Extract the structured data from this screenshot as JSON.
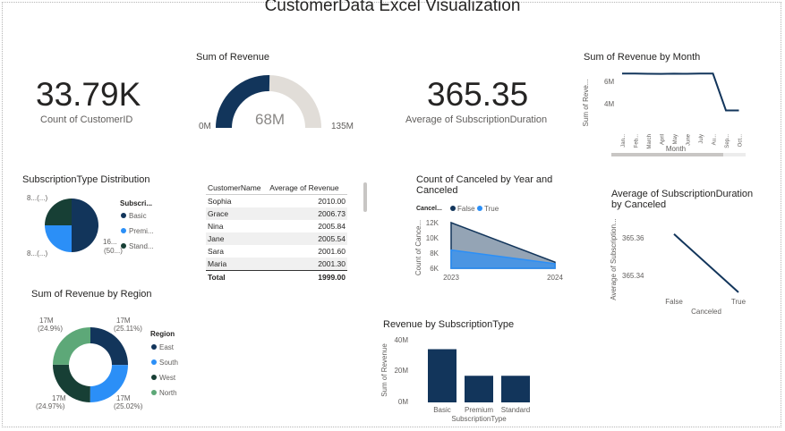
{
  "report": {
    "title": "CustomerData Excel Visualization"
  },
  "kpi_count": {
    "value": "33.79K",
    "label": "Count of CustomerID"
  },
  "gauge": {
    "title": "Sum of Revenue",
    "value": "68M",
    "min": "0M",
    "max": "135M",
    "fraction": 0.504
  },
  "kpi_duration": {
    "value": "365.35",
    "label": "Average of SubscriptionDuration"
  },
  "month_chart": {
    "title": "Sum of Revenue by Month",
    "ylabel": "Sum of Reve...",
    "xlabel": "Month",
    "yticks": [
      "6M",
      "4M"
    ],
    "months": [
      "Jan...",
      "Feb...",
      "March",
      "April",
      "May",
      "June",
      "July",
      "Au...",
      "Sep...",
      "Oct..."
    ],
    "values": [
      6.7,
      6.7,
      6.68,
      6.67,
      6.69,
      6.68,
      6.7,
      6.7,
      3.4,
      3.4
    ]
  },
  "sub_pie": {
    "title": "SubscriptionType Distribution",
    "legend_title": "Subscri...",
    "legend": [
      {
        "label": "Basic",
        "color": "#12355b"
      },
      {
        "label": "Premi...",
        "color": "#2b8ff7"
      },
      {
        "label": "Stand...",
        "color": "#173f35"
      }
    ],
    "labels": {
      "top": "8...(...)",
      "right": "16...",
      "right2": "(50...)",
      "bottom": "8...(...)"
    }
  },
  "table": {
    "headers": [
      "CustomerName",
      "Average of Revenue"
    ],
    "rows": [
      [
        "Sophia",
        "2010.00"
      ],
      [
        "Grace",
        "2006.73"
      ],
      [
        "Nina",
        "2005.84"
      ],
      [
        "Jane",
        "2005.54"
      ],
      [
        "Sara",
        "2001.60"
      ],
      [
        "Maria",
        "2001.30"
      ]
    ],
    "total": [
      "Total",
      "1999.00"
    ]
  },
  "area_chart": {
    "title": "Count of Canceled by Year and Canceled",
    "legend_title": "Cancel...",
    "legend": [
      {
        "label": "False",
        "color": "#12355b"
      },
      {
        "label": "True",
        "color": "#2b8ff7"
      }
    ],
    "ylabel": "Count of Cance...",
    "yticks": [
      "12K",
      "10K",
      "8K",
      "6K"
    ],
    "x": [
      "2023",
      "2024"
    ],
    "false_values": [
      12,
      6.8
    ],
    "true_values": [
      8.4,
      6.6
    ]
  },
  "cancel_line": {
    "title": "Average of SubscriptionDuration by Canceled",
    "ylabel": "Average of Subscription...",
    "xlabel": "Canceled",
    "yticks": [
      "365.36",
      "365.34"
    ],
    "x": [
      "False",
      "True"
    ],
    "values": [
      365.362,
      365.331
    ]
  },
  "region_donut": {
    "title": "Sum of Revenue by Region",
    "legend_title": "Region",
    "legend": [
      {
        "label": "East",
        "color": "#12355b"
      },
      {
        "label": "South",
        "color": "#2b8ff7"
      },
      {
        "label": "West",
        "color": "#173f35"
      },
      {
        "label": "North",
        "color": "#5da878"
      }
    ],
    "slices": [
      {
        "region": "East",
        "pct": 25.11,
        "label1": "17M",
        "label2": "(25.11%)"
      },
      {
        "region": "South",
        "pct": 25.02,
        "label1": "17M",
        "label2": "(25.02%)"
      },
      {
        "region": "West",
        "pct": 24.97,
        "label1": "17M",
        "label2": "(24.97%)"
      },
      {
        "region": "North",
        "pct": 24.9,
        "label1": "17M",
        "label2": "(24.9%)"
      }
    ]
  },
  "bar_chart": {
    "title": "Revenue by SubscriptionType",
    "ylabel": "Sum of Revenue",
    "xlabel": "SubscriptionType",
    "yticks": [
      "40M",
      "20M",
      "0M"
    ],
    "categories": [
      "Basic",
      "Premium",
      "Standard"
    ],
    "values": [
      34,
      17,
      17
    ]
  },
  "chart_data": [
    {
      "type": "line",
      "title": "Sum of Revenue by Month",
      "x": [
        "Jan...",
        "Feb...",
        "March",
        "April",
        "May",
        "June",
        "July",
        "Au...",
        "Sep...",
        "Oct..."
      ],
      "values": [
        6.7,
        6.7,
        6.68,
        6.67,
        6.69,
        6.68,
        6.7,
        6.7,
        3.4,
        3.4
      ],
      "xlabel": "Month",
      "ylabel": "Sum of Reve..."
    },
    {
      "type": "area",
      "title": "Count of Canceled by Year and Canceled",
      "x": [
        "2023",
        "2024"
      ],
      "series": [
        {
          "name": "False",
          "values": [
            12,
            6.8
          ]
        },
        {
          "name": "True",
          "values": [
            8.4,
            6.6
          ]
        }
      ]
    },
    {
      "type": "line",
      "title": "Average of SubscriptionDuration by Canceled",
      "x": [
        "False",
        "True"
      ],
      "values": [
        365.362,
        365.331
      ]
    },
    {
      "type": "bar",
      "title": "Revenue by SubscriptionType",
      "categories": [
        "Basic",
        "Premium",
        "Standard"
      ],
      "values": [
        34,
        17,
        17
      ],
      "ylim": [
        0,
        40
      ]
    },
    {
      "type": "pie",
      "title": "Sum of Revenue by Region",
      "categories": [
        "East",
        "South",
        "West",
        "North"
      ],
      "values": [
        25.11,
        25.02,
        24.97,
        24.9
      ]
    }
  ]
}
